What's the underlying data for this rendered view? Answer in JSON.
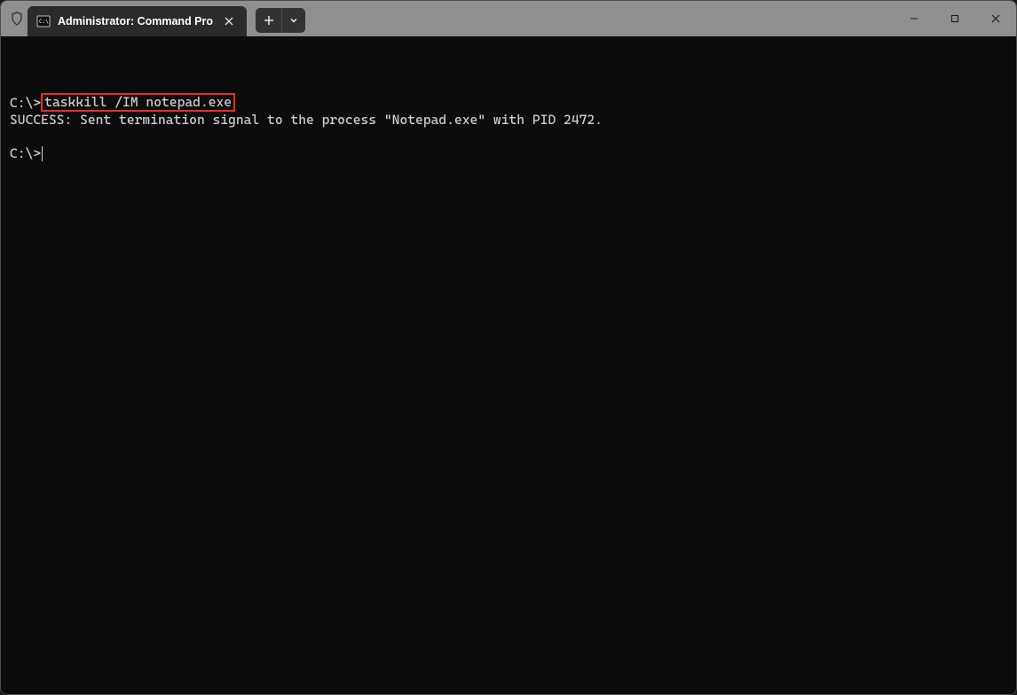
{
  "titlebar": {
    "tab_title": "Administrator: Command Pro"
  },
  "terminal": {
    "prompt1_prefix": "C:\\>",
    "command_highlighted": "taskkill /IM notepad.exe",
    "output_line": "SUCCESS: Sent termination signal to the process \"Notepad.exe\" with PID 2472.",
    "prompt2": "C:\\>"
  }
}
